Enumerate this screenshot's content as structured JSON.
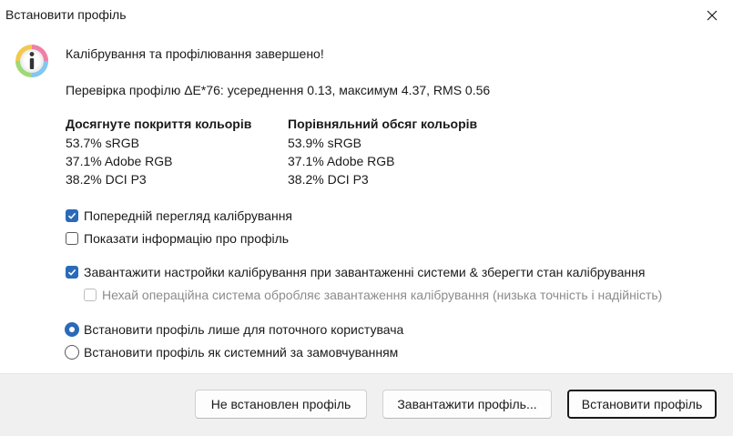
{
  "window": {
    "title": "Встановити профіль",
    "close_icon": "close-icon"
  },
  "main": {
    "icon": "info-icon",
    "headline": "Калібрування та профілювання завершено!",
    "profile_check": "Перевірка профілю ΔE*76: усереднення 0.13, максимум 4.37, RMS 0.56",
    "coverage": {
      "header": "Досягнуте покриття кольорів",
      "items": [
        "53.7% sRGB",
        "37.1% Adobe RGB",
        "38.2% DCI P3"
      ]
    },
    "volume": {
      "header": "Порівняльний обсяг кольорів",
      "items": [
        "53.9% sRGB",
        "37.1% Adobe RGB",
        "38.2% DCI P3"
      ]
    }
  },
  "options": {
    "preview_calibration": {
      "label": "Попередній перегляд калібрування",
      "checked": true
    },
    "show_profile_info": {
      "label": "Показати інформацію про профіль",
      "checked": false
    },
    "load_on_startup": {
      "label": "Завантажити настройки калібрування при завантаженні системи & зберегти стан калібрування",
      "checked": true
    },
    "os_handles": {
      "label": "Нехай операційна система обробляє завантаження калібрування (низька точність і надійність)",
      "checked": false,
      "disabled": true
    },
    "install_current_user": {
      "label": "Встановити профіль лише для поточного користувача",
      "selected": true
    },
    "install_system_default": {
      "label": "Встановити профіль як системний за замовчуванням",
      "selected": false
    }
  },
  "buttons": {
    "not_installed": "Не встановлен профіль",
    "load_profile": "Завантажити профіль...",
    "install": "Встановити профіль"
  },
  "colors": {
    "accent": "#2a6ab8",
    "footer_bg": "#f0f0f0"
  }
}
